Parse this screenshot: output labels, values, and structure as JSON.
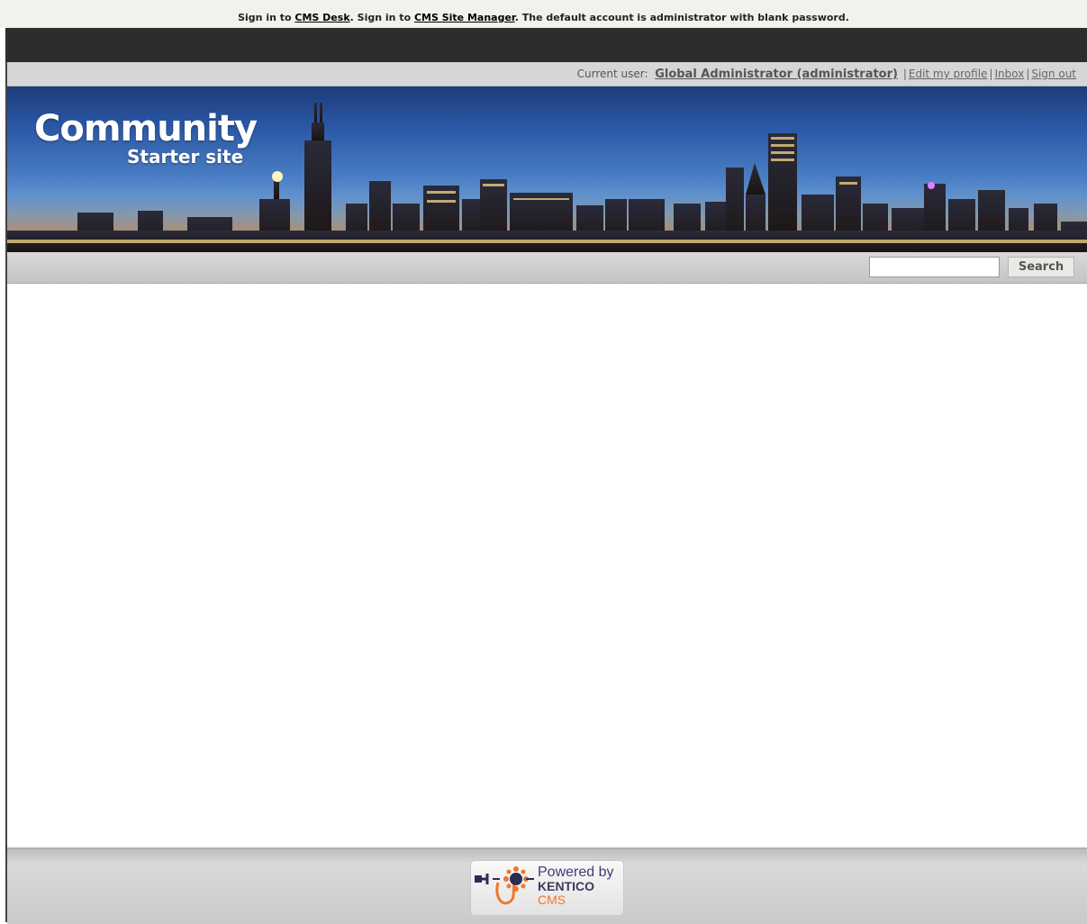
{
  "notice": {
    "part1": "Sign in to ",
    "cms_desk": "CMS Desk",
    "part2": ". Sign in to ",
    "site_manager": "CMS Site Manager",
    "part3": ". The default account is administrator with blank password."
  },
  "userbar": {
    "current_user_label": "Current user:",
    "user_name": "Global Administrator (administrator)",
    "edit_profile": "Edit my profile",
    "inbox": "Inbox",
    "sign_out": "Sign out",
    "separator": "|"
  },
  "banner": {
    "title": "Community",
    "subtitle": "Starter site"
  },
  "search": {
    "value": "",
    "button_label": "Search"
  },
  "footer": {
    "powered": "Powered by",
    "brand": "KENTICO",
    "product": "CMS"
  },
  "colors": {
    "notice_bg": "#f3f1ec",
    "dark_bar": "#2d2d2d",
    "userbar_bg": "#d6d6d6",
    "kentico_orange": "#f0762a",
    "kentico_blue": "#3c3c78"
  }
}
